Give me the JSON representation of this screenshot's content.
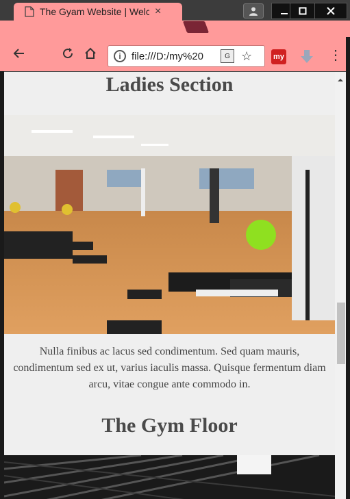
{
  "browser": {
    "tab_title": "The Gyam Website | Welc",
    "tab_close": "×",
    "url": "file:///D:/my%20",
    "extension_label": "my"
  },
  "page": {
    "section1_heading": "Ladies Section",
    "section1_paragraph": "Nulla finibus ac lacus sed condimentum. Sed quam mauris, condimentum sed ex ut, varius iaculis massa. Quisque fermentum diam arcu, vitae congue ante commodo in.",
    "section2_heading": "The Gym Floor"
  },
  "colors": {
    "tab_bg": "#ff9a9a",
    "page_bg": "#efefef",
    "heading": "#4a4a4a"
  }
}
